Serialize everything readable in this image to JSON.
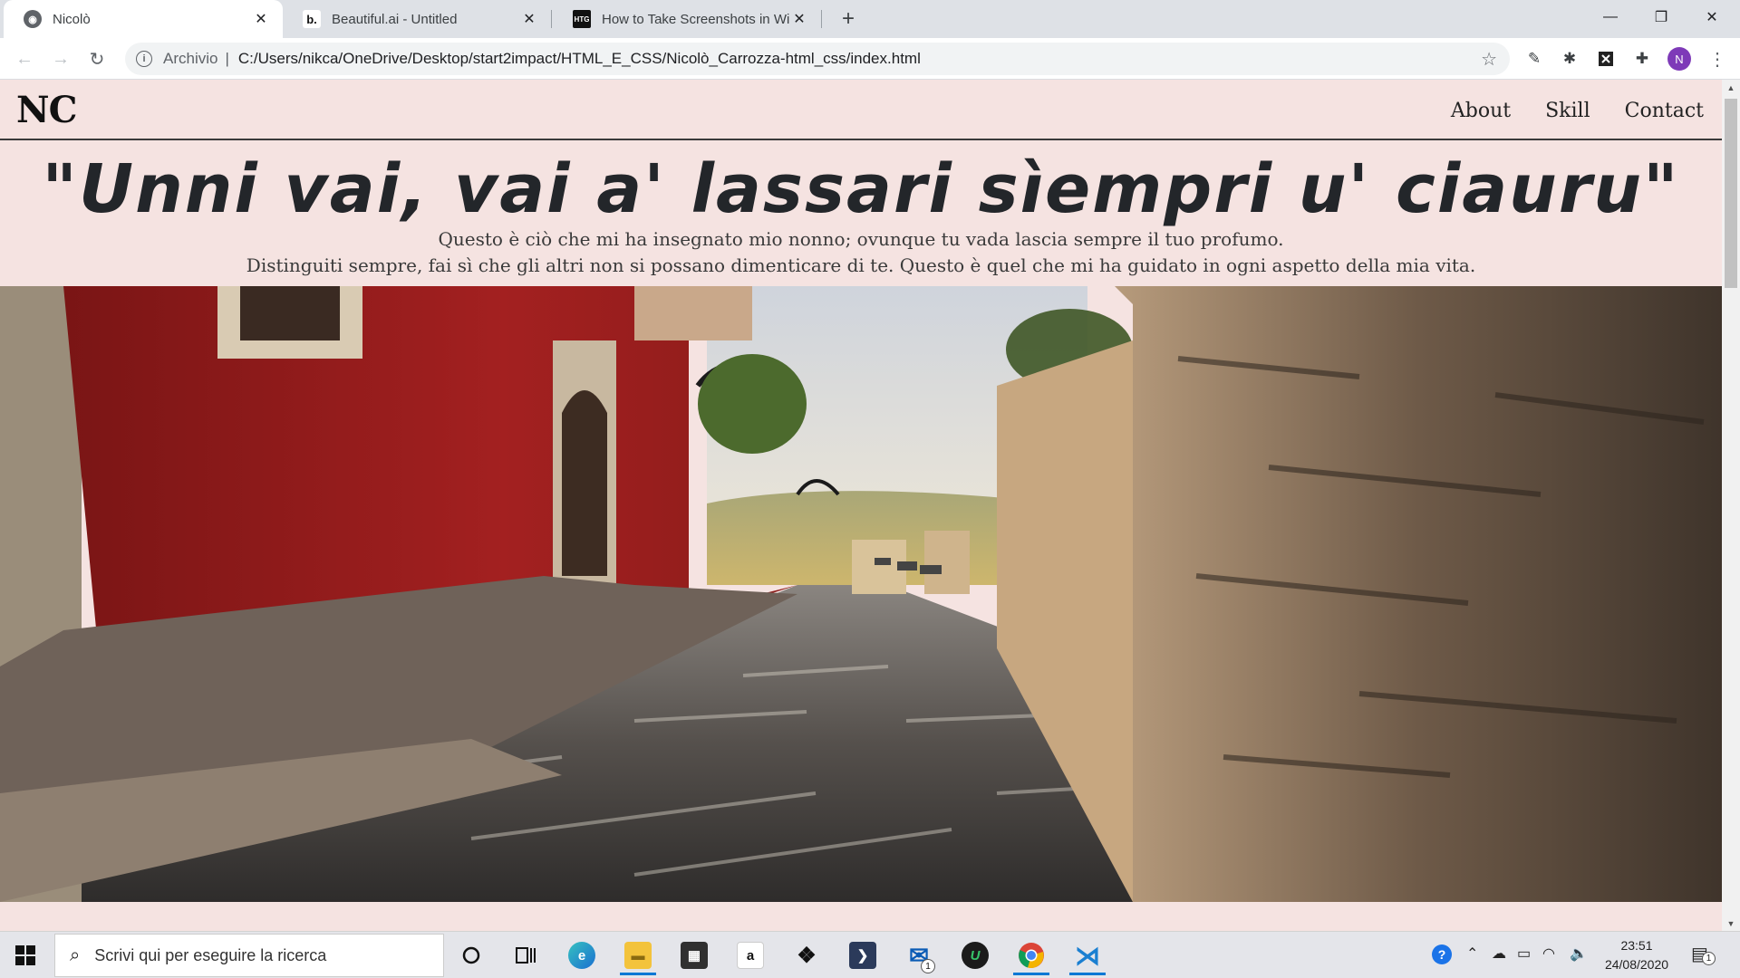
{
  "browser": {
    "tabs": [
      {
        "title": "Nicolò",
        "active": true
      },
      {
        "title": "Beautiful.ai - Untitled",
        "active": false,
        "favicon_text": "b."
      },
      {
        "title": "How to Take Screenshots in Windc",
        "active": false,
        "favicon_text": "HTG"
      }
    ],
    "address": {
      "security_chip": "Archivio",
      "url": "C:/Users/nikca/OneDrive/Desktop/start2impact/HTML_E_CSS/Nicolò_Carrozza-html_css/index.html"
    },
    "profile_initial": "N"
  },
  "site": {
    "logo": "NC",
    "nav": [
      "About",
      "Skill",
      "Contact"
    ],
    "quote": "\"Unni vai, vai a' lassari sìempri u' ciauru\"",
    "subtitle_lines": [
      "Questo è ciò che mi ha insegnato mio nonno; ovunque tu vada lascia sempre il tuo profumo.",
      "Distinguiti sempre, fai sì che gli altri non si possano dimenticare di te. Questo è quel che mi ha guidato in ogni aspetto della mia vita."
    ]
  },
  "taskbar": {
    "search_placeholder": "Scrivi qui per eseguire la ricerca",
    "clock_time": "23:51",
    "clock_date": "24/08/2020",
    "mail_badge": "1",
    "notification_badge": "1"
  },
  "colors": {
    "page_bg": "#f5e3e1",
    "quote": "#23262a",
    "profile": "#7e3ab8"
  }
}
